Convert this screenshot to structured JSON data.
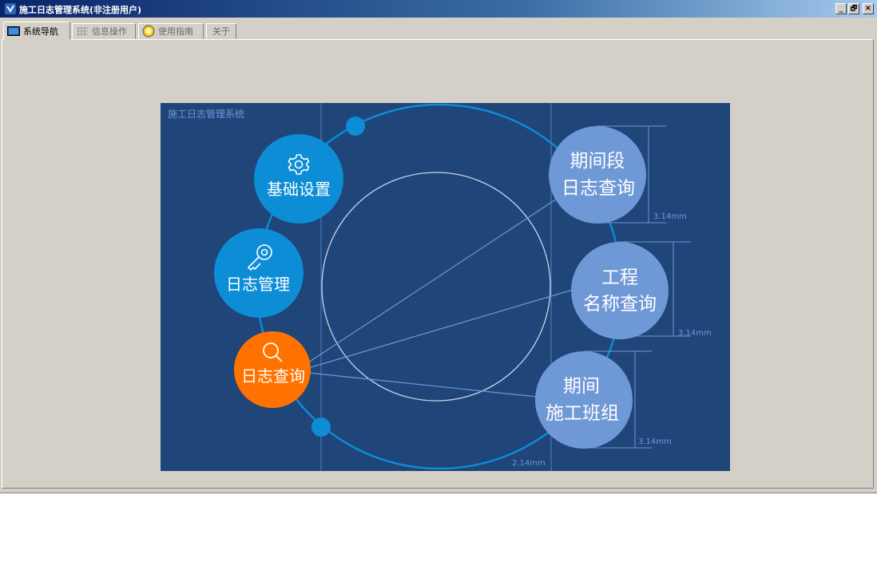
{
  "window": {
    "title": "施工日志管理系统(非注册用户)",
    "controls": {
      "minimize": "_",
      "restore": "🗗",
      "close": "×"
    }
  },
  "tabs": [
    {
      "label": "系统导航",
      "icon": "monitor-icon",
      "active": true
    },
    {
      "label": "信息操作",
      "icon": "grid-icon",
      "active": false
    },
    {
      "label": "使用指南",
      "icon": "help-icon",
      "active": false
    },
    {
      "label": "关于",
      "icon": "",
      "active": false
    }
  ],
  "diagram": {
    "heading": "施工日志管理系统",
    "nodes": {
      "basic_settings": {
        "label": "基础设置",
        "icon": "gear-icon"
      },
      "log_management": {
        "label": "日志管理",
        "icon": "key-icon"
      },
      "log_query": {
        "label": "日志查询",
        "icon": "search-icon"
      },
      "period_query": {
        "line1": "期间段",
        "line2": "日志查询"
      },
      "project_query": {
        "line1": "工程",
        "line2": "名称查询"
      },
      "team_query": {
        "line1": "期间",
        "line2": "施工班组"
      }
    },
    "dimensions": {
      "d1": "3.14mm",
      "d2": "3.14mm",
      "d3": "3.14mm",
      "bottom": "2.14mm"
    },
    "colors": {
      "background": "#1f4579",
      "blue": "#0c8dd6",
      "orange": "#ff7200",
      "light": "#6f98d6"
    }
  }
}
